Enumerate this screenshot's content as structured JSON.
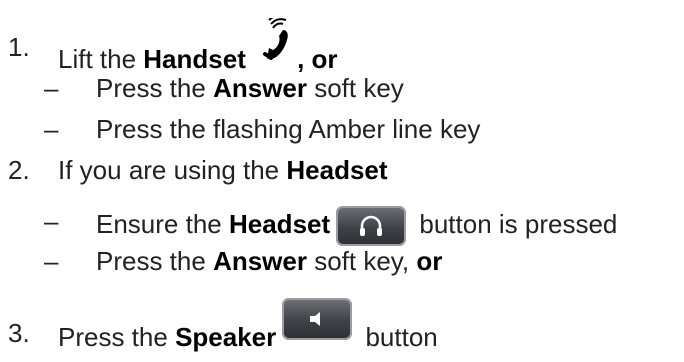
{
  "steps": [
    {
      "num": "1.",
      "pre": "Lift the ",
      "bold": "Handset",
      "post": ", or",
      "icon": "handset-ringing-icon",
      "subs": [
        {
          "pre": "Press the ",
          "bold": "Answer",
          "post": " soft key"
        },
        {
          "pre": "Press the flashing Amber line key",
          "bold": "",
          "post": ""
        }
      ]
    },
    {
      "num": "2.",
      "pre": "If you are using the ",
      "bold": "Headset",
      "post": "",
      "subs": [
        {
          "pre": "Ensure the ",
          "bold": "Headset",
          "post": " button is pressed",
          "icon": "headset-icon"
        },
        {
          "pre": "Press the ",
          "bold": "Answer",
          "post": " soft key, ",
          "bold2": "or"
        }
      ]
    },
    {
      "num": "3.",
      "pre": "Press the ",
      "bold": "Speaker",
      "post": " button",
      "icon": "speaker-icon"
    }
  ],
  "dash": "–",
  "colors": {
    "text": "#222222",
    "key": "#3e4246"
  }
}
